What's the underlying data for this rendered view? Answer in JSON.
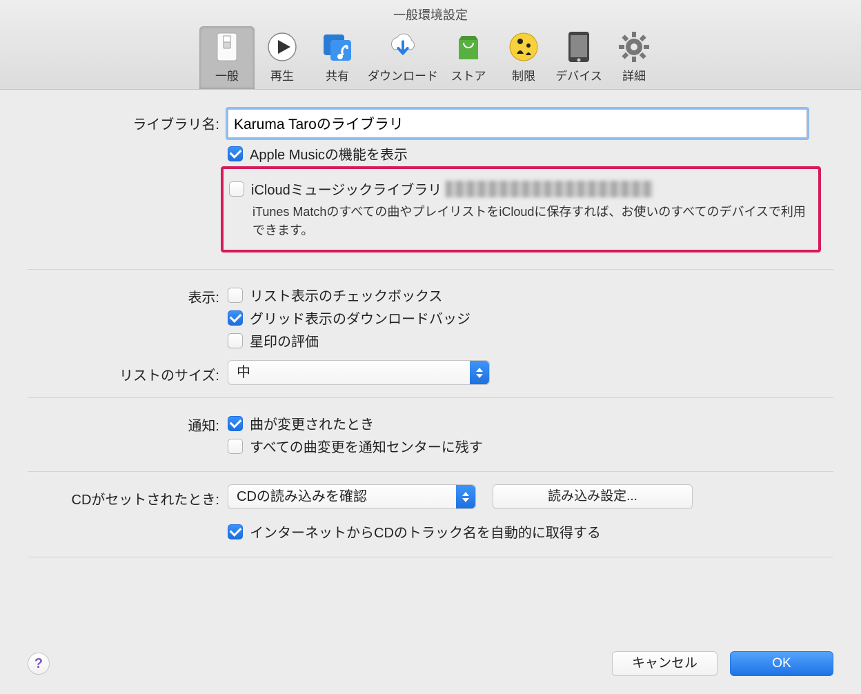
{
  "window": {
    "title": "一般環境設定"
  },
  "toolbar": {
    "tabs": [
      {
        "label": "一般"
      },
      {
        "label": "再生"
      },
      {
        "label": "共有"
      },
      {
        "label": "ダウンロード"
      },
      {
        "label": "ストア"
      },
      {
        "label": "制限"
      },
      {
        "label": "デバイス"
      },
      {
        "label": "詳細"
      }
    ]
  },
  "library": {
    "label": "ライブラリ名:",
    "value": "Karuma Taroのライブラリ",
    "apple_music": "Apple Musicの機能を表示",
    "icloud_label": "iCloudミュージックライブラリ",
    "icloud_desc": "iTunes Matchのすべての曲やプレイリストをiCloudに保存すれば、お使いのすべてのデバイスで利用できます。"
  },
  "display": {
    "label": "表示:",
    "list_checkbox": "リスト表示のチェックボックス",
    "grid_badge": "グリッド表示のダウンロードバッジ",
    "star_rating": "星印の評価"
  },
  "list_size": {
    "label": "リストのサイズ:",
    "value": "中"
  },
  "notify": {
    "label": "通知:",
    "song_changed": "曲が変更されたとき",
    "keep_all": "すべての曲変更を通知センターに残す"
  },
  "cd": {
    "label": "CDがセットされたとき:",
    "value": "CDの読み込みを確認",
    "import_settings": "読み込み設定...",
    "auto_fetch": "インターネットからCDのトラック名を自動的に取得する"
  },
  "footer": {
    "cancel": "キャンセル",
    "ok": "OK",
    "help": "?"
  }
}
